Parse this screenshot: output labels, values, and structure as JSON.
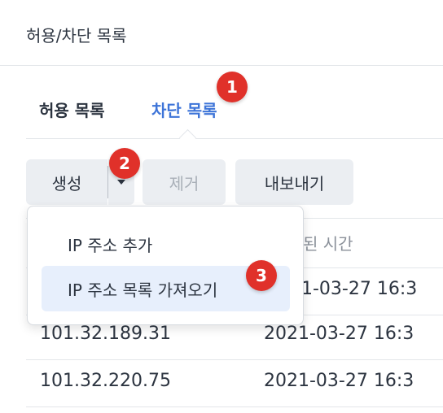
{
  "header": {
    "title": "허용/차단 목록"
  },
  "tabs": [
    {
      "label": "허용 목록",
      "active": false
    },
    {
      "label": "차단 목록",
      "active": true
    }
  ],
  "toolbar": {
    "create_label": "생성",
    "remove_label": "제거",
    "export_label": "내보내기"
  },
  "table": {
    "header_time": "된 시간",
    "rows": [
      {
        "ip": "101.32.189.31",
        "time": "2021-03-27 16:3"
      },
      {
        "ip": "101.32.220.75",
        "time": "2021-03-27 16:3"
      }
    ],
    "partial_row_time_1": "2021-03-27 16:3",
    "partial_row_time_2": "1-03-27 16:3"
  },
  "dropdown": {
    "items": [
      {
        "label": "IP 주소 추가"
      },
      {
        "label": "IP 주소 목록 가져오기"
      }
    ]
  },
  "badges": [
    "1",
    "2",
    "3"
  ],
  "colors": {
    "accent": "#3d74d8",
    "badge": "#e0312a",
    "button_bg": "#ebeef2",
    "menu_highlight": "#e7effc"
  }
}
